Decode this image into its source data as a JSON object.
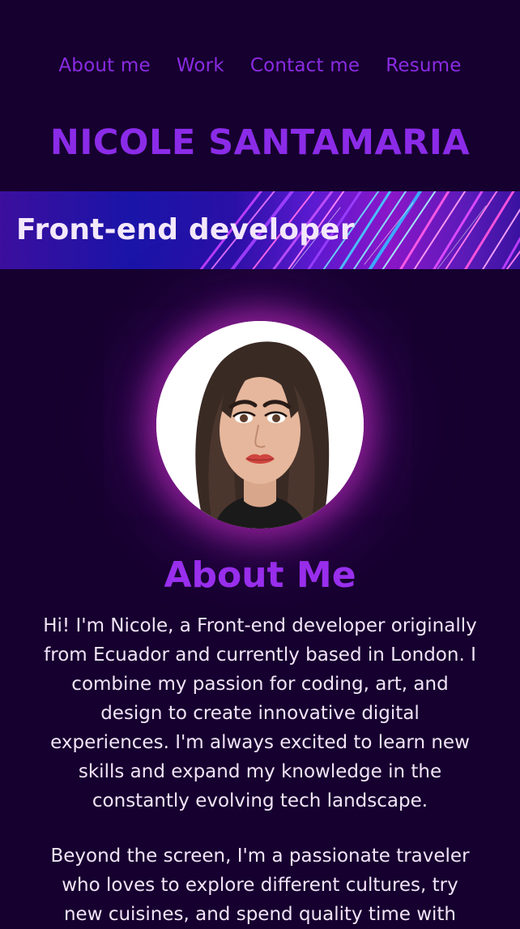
{
  "nav": {
    "items": [
      {
        "label": "About me"
      },
      {
        "label": "Work"
      },
      {
        "label": "Contact me"
      },
      {
        "label": "Resume"
      }
    ]
  },
  "header": {
    "title": "NICOLE SANTAMARIA"
  },
  "banner": {
    "text": "Front-end developer"
  },
  "about": {
    "title": "About Me",
    "paragraph1": "Hi! I'm Nicole, a Front-end developer originally from Ecuador and currently based in London. I combine my passion for coding, art, and design to create innovative digital experiences. I'm always excited to learn new skills and expand my knowledge in the constantly evolving tech landscape.",
    "paragraph2": "Beyond the screen, I'm a passionate traveler who loves to explore different cultures, try new cuisines, and spend quality time with"
  },
  "colors": {
    "background": "#16002f",
    "accent": "#8a2be2",
    "text": "#f3e4f7"
  }
}
